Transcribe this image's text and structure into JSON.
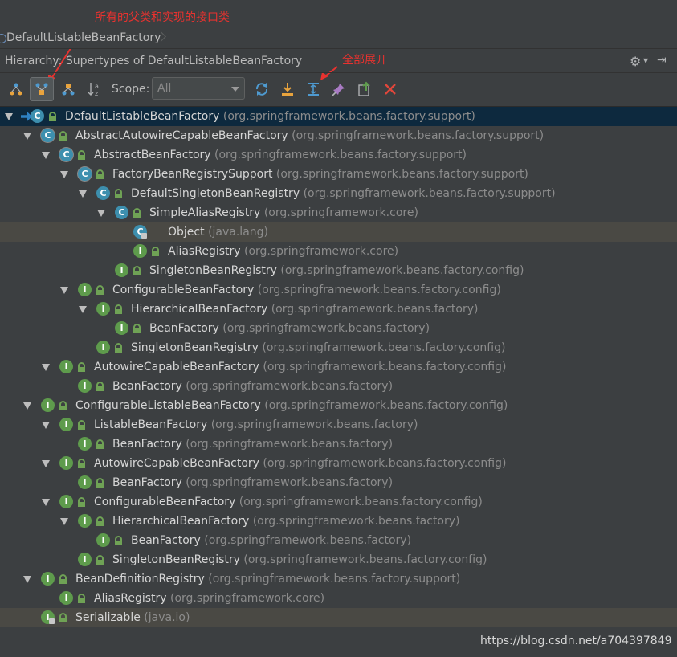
{
  "annotations": {
    "top_note": "所有的父类和实现的接口类",
    "expand_note": "全部展开"
  },
  "breadcrumb": {
    "label": "DefaultListableBeanFactory"
  },
  "panel": {
    "title": "Hierarchy: Supertypes of DefaultListableBeanFactory"
  },
  "toolbar": {
    "scope_label": "Scope:",
    "scope_value": "All",
    "buttons": [
      "class-hierarchy-icon",
      "supertypes-icon",
      "subtypes-icon",
      "sort-alpha-icon",
      "refresh-icon",
      "autoscroll-to-source-icon",
      "expand-all-icon",
      "pin-icon",
      "export-icon",
      "close-icon"
    ]
  },
  "tree": [
    {
      "name": "DefaultListableBeanFactory",
      "pkg": "(org.springframework.beans.factory.support)",
      "kind": "C"
    },
    {
      "name": "AbstractAutowireCapableBeanFactory",
      "pkg": "(org.springframework.beans.factory.support)",
      "kind": "C"
    },
    {
      "name": "AbstractBeanFactory",
      "pkg": "(org.springframework.beans.factory.support)",
      "kind": "C"
    },
    {
      "name": "FactoryBeanRegistrySupport",
      "pkg": "(org.springframework.beans.factory.support)",
      "kind": "C"
    },
    {
      "name": "DefaultSingletonBeanRegistry",
      "pkg": "(org.springframework.beans.factory.support)",
      "kind": "C"
    },
    {
      "name": "SimpleAliasRegistry",
      "pkg": "(org.springframework.core)",
      "kind": "C"
    },
    {
      "name": "Object",
      "pkg": "(java.lang)",
      "kind": "C"
    },
    {
      "name": "AliasRegistry",
      "pkg": "(org.springframework.core)",
      "kind": "I"
    },
    {
      "name": "SingletonBeanRegistry",
      "pkg": "(org.springframework.beans.factory.config)",
      "kind": "I"
    },
    {
      "name": "ConfigurableBeanFactory",
      "pkg": "(org.springframework.beans.factory.config)",
      "kind": "I"
    },
    {
      "name": "HierarchicalBeanFactory",
      "pkg": "(org.springframework.beans.factory)",
      "kind": "I"
    },
    {
      "name": "BeanFactory",
      "pkg": "(org.springframework.beans.factory)",
      "kind": "I"
    },
    {
      "name": "SingletonBeanRegistry",
      "pkg": "(org.springframework.beans.factory.config)",
      "kind": "I"
    },
    {
      "name": "AutowireCapableBeanFactory",
      "pkg": "(org.springframework.beans.factory.config)",
      "kind": "I"
    },
    {
      "name": "BeanFactory",
      "pkg": "(org.springframework.beans.factory)",
      "kind": "I"
    },
    {
      "name": "ConfigurableListableBeanFactory",
      "pkg": "(org.springframework.beans.factory.config)",
      "kind": "I"
    },
    {
      "name": "ListableBeanFactory",
      "pkg": "(org.springframework.beans.factory)",
      "kind": "I"
    },
    {
      "name": "BeanFactory",
      "pkg": "(org.springframework.beans.factory)",
      "kind": "I"
    },
    {
      "name": "AutowireCapableBeanFactory",
      "pkg": "(org.springframework.beans.factory.config)",
      "kind": "I"
    },
    {
      "name": "BeanFactory",
      "pkg": "(org.springframework.beans.factory)",
      "kind": "I"
    },
    {
      "name": "ConfigurableBeanFactory",
      "pkg": "(org.springframework.beans.factory.config)",
      "kind": "I"
    },
    {
      "name": "HierarchicalBeanFactory",
      "pkg": "(org.springframework.beans.factory)",
      "kind": "I"
    },
    {
      "name": "BeanFactory",
      "pkg": "(org.springframework.beans.factory)",
      "kind": "I"
    },
    {
      "name": "SingletonBeanRegistry",
      "pkg": "(org.springframework.beans.factory.config)",
      "kind": "I"
    },
    {
      "name": "BeanDefinitionRegistry",
      "pkg": "(org.springframework.beans.factory.support)",
      "kind": "I"
    },
    {
      "name": "AliasRegistry",
      "pkg": "(org.springframework.core)",
      "kind": "I"
    },
    {
      "name": "Serializable",
      "pkg": "(java.io)",
      "kind": "I"
    }
  ],
  "watermark": "https://blog.csdn.net/a704397849",
  "colors": {
    "selected_row": "#0d293e",
    "class_icon": "#3d8fae",
    "interface_icon": "#5e9b4c",
    "annotation": "#e8322f"
  }
}
